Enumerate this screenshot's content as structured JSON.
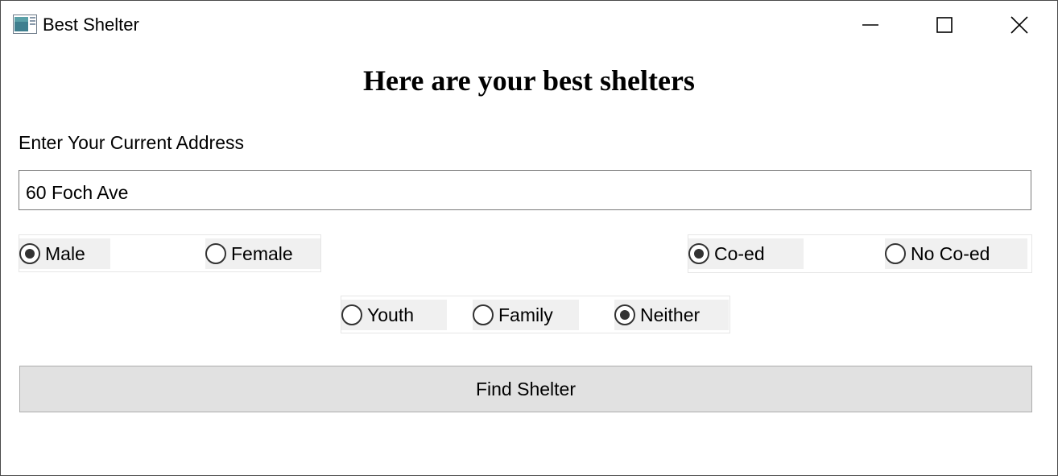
{
  "window": {
    "title": "Best Shelter",
    "controls": {
      "minimize": "minimize-icon",
      "maximize": "maximize-icon",
      "close": "close-icon"
    }
  },
  "heading": "Here are your best shelters",
  "address": {
    "label": "Enter Your Current Address",
    "value": "60 Foch Ave"
  },
  "gender": {
    "options": [
      {
        "label": "Male",
        "checked": true
      },
      {
        "label": "Female",
        "checked": false
      }
    ]
  },
  "coed": {
    "options": [
      {
        "label": "Co-ed",
        "checked": true
      },
      {
        "label": "No Co-ed",
        "checked": false
      }
    ]
  },
  "category": {
    "options": [
      {
        "label": "Youth",
        "checked": false
      },
      {
        "label": "Family",
        "checked": false
      },
      {
        "label": "Neither",
        "checked": true
      }
    ]
  },
  "find_button": "Find Shelter",
  "colors": {
    "button_bg": "#e1e1e1",
    "radio_bg": "#f0f0f0",
    "radio_fill": "#333333"
  }
}
